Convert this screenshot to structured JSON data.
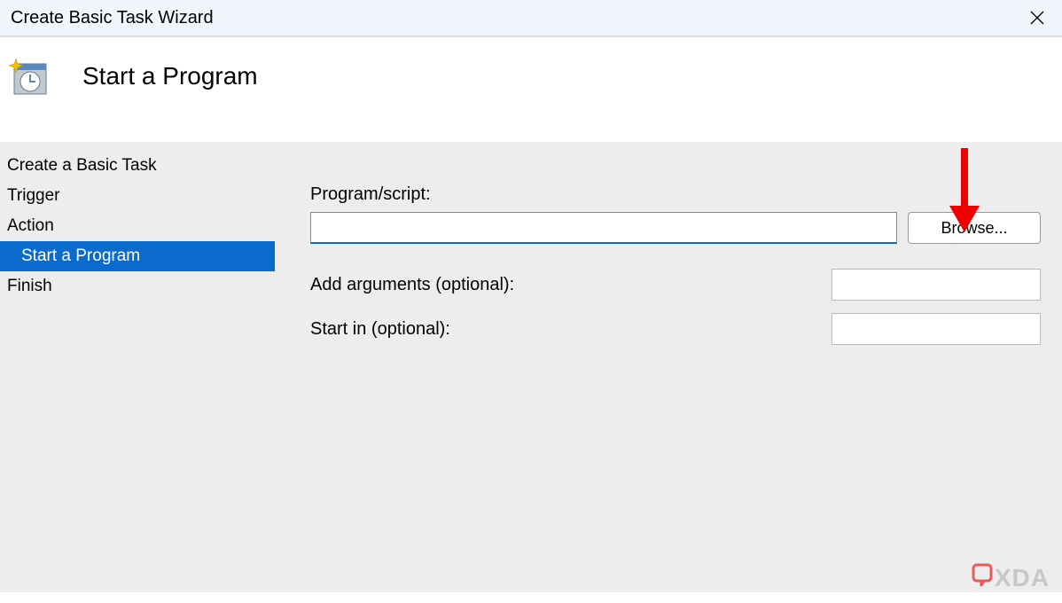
{
  "window": {
    "title": "Create Basic Task Wizard"
  },
  "header": {
    "title": "Start a Program"
  },
  "sidebar": {
    "items": [
      {
        "label": "Create a Basic Task",
        "selected": false,
        "sub": false
      },
      {
        "label": "Trigger",
        "selected": false,
        "sub": false
      },
      {
        "label": "Action",
        "selected": false,
        "sub": false
      },
      {
        "label": "Start a Program",
        "selected": true,
        "sub": true
      },
      {
        "label": "Finish",
        "selected": false,
        "sub": false
      }
    ]
  },
  "form": {
    "program_label": "Program/script:",
    "program_value": "",
    "browse_label": "Browse...",
    "arguments_label": "Add arguments (optional):",
    "arguments_value": "",
    "startin_label": "Start in (optional):",
    "startin_value": ""
  },
  "watermark": {
    "text": "XDA"
  }
}
